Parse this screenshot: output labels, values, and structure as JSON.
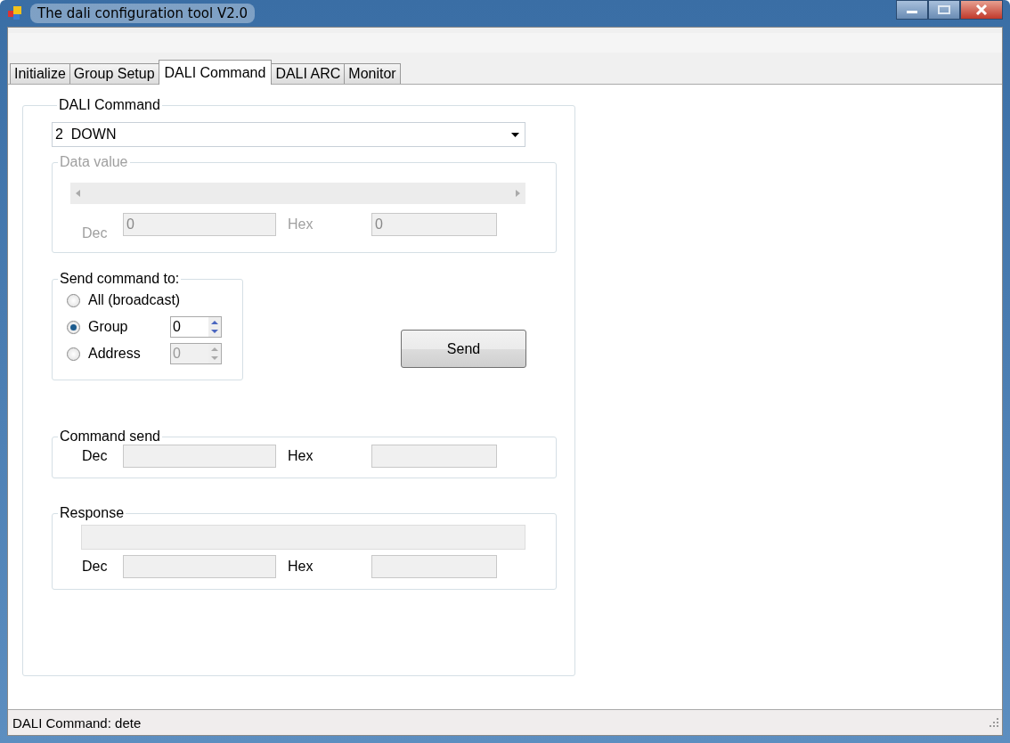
{
  "window": {
    "title": "The dali configuration tool V2.0"
  },
  "tabs": [
    {
      "label": "Initialize",
      "selected": false
    },
    {
      "label": "Group Setup",
      "selected": false
    },
    {
      "label": "DALI Command",
      "selected": true
    },
    {
      "label": "DALI ARC",
      "selected": false
    },
    {
      "label": "Monitor",
      "selected": false
    }
  ],
  "dali_command": {
    "title": "DALI Command",
    "command": "2  DOWN",
    "data_value": {
      "title": "Data value",
      "disabled": true,
      "dec_label": "Dec",
      "dec_value": "0",
      "hex_label": "Hex",
      "hex_value": "0"
    },
    "send_to": {
      "title": "Send command to:",
      "options": [
        {
          "label": "All (broadcast)",
          "selected": false
        },
        {
          "label": "Group",
          "selected": true,
          "value": "0"
        },
        {
          "label": "Address",
          "selected": false,
          "value": "0"
        }
      ]
    },
    "send_button": "Send",
    "command_send": {
      "title": "Command send",
      "dec_label": "Dec",
      "hex_label": "Hex"
    },
    "response": {
      "title": "Response",
      "dec_label": "Dec",
      "hex_label": "Hex"
    }
  },
  "status_bar": "DALI Command: dete"
}
